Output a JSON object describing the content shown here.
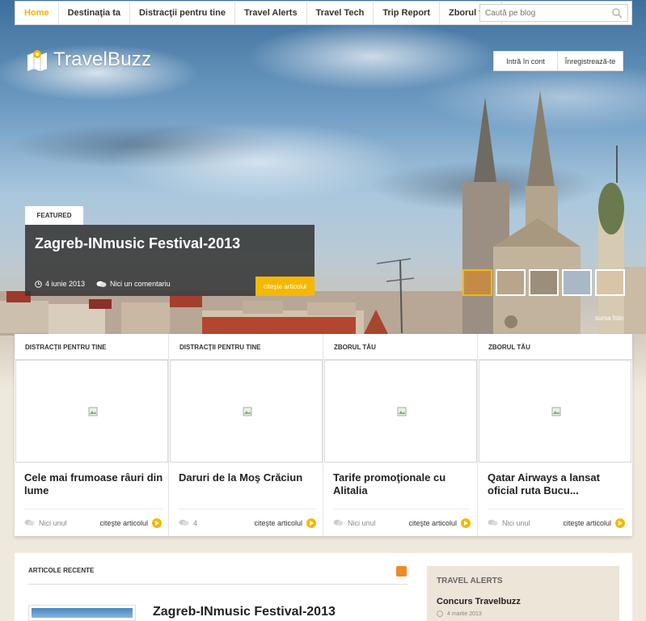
{
  "nav": {
    "items": [
      {
        "label": "Home",
        "active": true
      },
      {
        "label": "Destinaţia ta",
        "active": false
      },
      {
        "label": "Distracţii pentru tine",
        "active": false
      },
      {
        "label": "Travel Alerts",
        "active": false
      },
      {
        "label": "Travel Tech",
        "active": false
      },
      {
        "label": "Trip Report",
        "active": false
      },
      {
        "label": "Zborul tău",
        "active": false
      }
    ],
    "search_placeholder": "Caută pe blog"
  },
  "logo": {
    "text": "TravelBuzz",
    "icon": "map-pin-icon"
  },
  "auth": {
    "login": "Intră în cont",
    "register": "Înregistrează-te"
  },
  "featured": {
    "tag": "FEATURED",
    "title": "Zagreb-INmusic Festival-2013",
    "date": "4 iunie 2013",
    "comments": "Nici un comentariu",
    "read_more": "citeşte articolul",
    "photo_source": "sursa foto"
  },
  "thumbnails": [
    {
      "color": "#c48a48",
      "active": true
    },
    {
      "color": "#b9a48c",
      "active": false
    },
    {
      "color": "#9b8e7a",
      "active": false
    },
    {
      "color": "#a8b8c4",
      "active": false
    },
    {
      "color": "#d8c4a6",
      "active": false
    }
  ],
  "cards": [
    {
      "category": "DISTRACŢII PENTRU TINE",
      "title": "Cele mai frumoase râuri din lume",
      "comments": "Nici unul",
      "read_more": "citeşte articolul"
    },
    {
      "category": "DISTRACŢII PENTRU TINE",
      "title": "Daruri de la Moş Crăciun",
      "comments": "4",
      "read_more": "citeşte articolul"
    },
    {
      "category": "ZBORUL TĂU",
      "title": "Tarife promoţionale cu Alitalia",
      "comments": "Nici unul",
      "read_more": "citeşte articolul"
    },
    {
      "category": "ZBORUL TĂU",
      "title": "Qatar Airways a lansat oficial ruta Bucu...",
      "comments": "Nici unul",
      "read_more": "citeşte articolul"
    }
  ],
  "recent": {
    "heading": "ARTICOLE RECENTE",
    "first_title": "Zagreb-INmusic Festival-2013"
  },
  "alerts": {
    "heading": "TRAVEL ALERTS",
    "item_title": "Concurs Travelbuzz",
    "item_date": "4 martie 2013"
  },
  "colors": {
    "accent": "#f5b800",
    "rss": "#f08a24"
  }
}
